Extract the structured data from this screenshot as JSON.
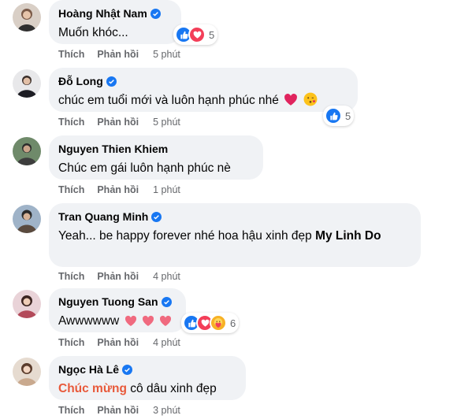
{
  "comments": [
    {
      "author": "Hoàng Nhật Nam",
      "verified": true,
      "text": "Muốn khóc...",
      "like": "Thích",
      "reply": "Phản hồi",
      "time": "5 phút",
      "reaction_count": "5"
    },
    {
      "author": "Đỗ Long",
      "verified": true,
      "text": "chúc em tuổi mới và luôn hạnh phúc nhé",
      "like": "Thích",
      "reply": "Phản hồi",
      "time": "5 phút",
      "reaction_count": "5"
    },
    {
      "author": "Nguyen Thien Khiem",
      "verified": false,
      "text": "Chúc em gái luôn hạnh phúc nè",
      "like": "Thích",
      "reply": "Phản hồi",
      "time": "1 phút"
    },
    {
      "author": "Tran Quang Minh",
      "verified": true,
      "text": "Yeah... be happy forever nhé hoa hậu xinh đẹp",
      "mention": "My Linh Do",
      "like": "Thích",
      "reply": "Phản hồi",
      "time": "4 phút"
    },
    {
      "author": "Nguyen Tuong San",
      "verified": true,
      "text": "Awwwwww",
      "like": "Thích",
      "reply": "Phản hồi",
      "time": "4 phút",
      "reaction_count": "6"
    },
    {
      "author": "Ngọc Hà Lê",
      "verified": true,
      "highlight": "Chúc mừng",
      "text": " cô dâu xinh đẹp",
      "like": "Thích",
      "reply": "Phản hồi",
      "time": "3 phút"
    }
  ],
  "colors": {
    "bubble": "#f0f2f5",
    "verified": "#1877f2",
    "meta": "#65676b",
    "highlight": "#e8593a",
    "like": "#1877f2",
    "love": "#f33e58"
  },
  "icons": [
    "verified-badge-icon",
    "like-reaction-icon",
    "love-reaction-icon",
    "care-reaction-icon",
    "heart-emoji-icon",
    "kiss-emoji-icon"
  ]
}
